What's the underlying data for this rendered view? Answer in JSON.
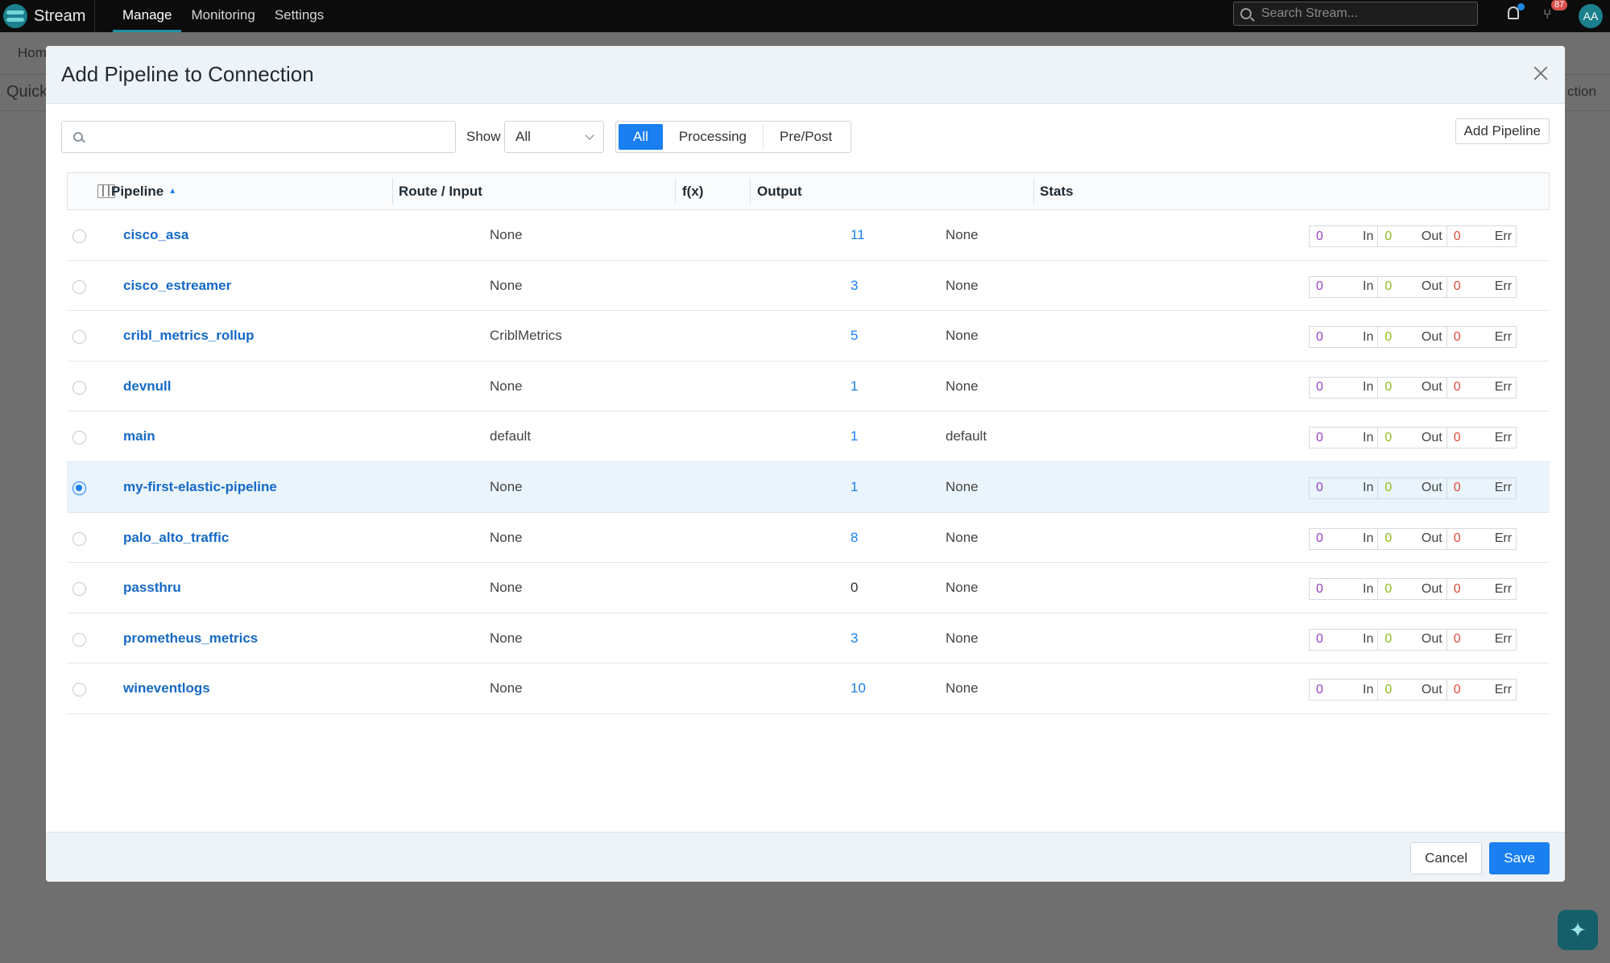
{
  "app": {
    "name": "Stream",
    "nav": [
      "Manage",
      "Monitoring",
      "Settings"
    ],
    "active_nav": "Manage",
    "search_placeholder": "Search Stream...",
    "notifications_badge": "87",
    "avatar_initials": "AA"
  },
  "background": {
    "breadcrumb_fragment": "Hom",
    "quick_fragment": "Quick",
    "right_fragment": "ction"
  },
  "modal": {
    "title": "Add Pipeline to Connection",
    "search_placeholder": "",
    "show_label": "Show",
    "show_value": "All",
    "segments": [
      "All",
      "Processing",
      "Pre/Post"
    ],
    "active_segment": "All",
    "add_pipeline_label": "Add Pipeline",
    "cancel_label": "Cancel",
    "save_label": "Save"
  },
  "table": {
    "headers": {
      "pipeline": "Pipeline",
      "route_input": "Route / Input",
      "fx": "f(x)",
      "output": "Output",
      "stats": "Stats"
    },
    "stat_labels": {
      "in": "In",
      "out": "Out",
      "err": "Err"
    },
    "rows": [
      {
        "name": "cisco_asa",
        "route": "None",
        "fx": "11",
        "output": "None",
        "in": "0",
        "out": "0",
        "err": "0",
        "selected": false
      },
      {
        "name": "cisco_estreamer",
        "route": "None",
        "fx": "3",
        "output": "None",
        "in": "0",
        "out": "0",
        "err": "0",
        "selected": false
      },
      {
        "name": "cribl_metrics_rollup",
        "route": "CriblMetrics",
        "fx": "5",
        "output": "None",
        "in": "0",
        "out": "0",
        "err": "0",
        "selected": false
      },
      {
        "name": "devnull",
        "route": "None",
        "fx": "1",
        "output": "None",
        "in": "0",
        "out": "0",
        "err": "0",
        "selected": false
      },
      {
        "name": "main",
        "route": "default",
        "fx": "1",
        "output": "default",
        "in": "0",
        "out": "0",
        "err": "0",
        "selected": false
      },
      {
        "name": "my-first-elastic-pipeline",
        "route": "None",
        "fx": "1",
        "output": "None",
        "in": "0",
        "out": "0",
        "err": "0",
        "selected": true
      },
      {
        "name": "palo_alto_traffic",
        "route": "None",
        "fx": "8",
        "output": "None",
        "in": "0",
        "out": "0",
        "err": "0",
        "selected": false
      },
      {
        "name": "passthru",
        "route": "None",
        "fx": "0",
        "output": "None",
        "in": "0",
        "out": "0",
        "err": "0",
        "selected": false
      },
      {
        "name": "prometheus_metrics",
        "route": "None",
        "fx": "3",
        "output": "None",
        "in": "0",
        "out": "0",
        "err": "0",
        "selected": false
      },
      {
        "name": "wineventlogs",
        "route": "None",
        "fx": "10",
        "output": "None",
        "in": "0",
        "out": "0",
        "err": "0",
        "selected": false
      }
    ]
  },
  "colors": {
    "accent": "#1a7ff0",
    "link": "#1569c7",
    "stat_in": "#9a3fc8",
    "stat_out": "#8fbc1e",
    "stat_err": "#e04a3c",
    "selected_row": "#e9f4fc"
  }
}
